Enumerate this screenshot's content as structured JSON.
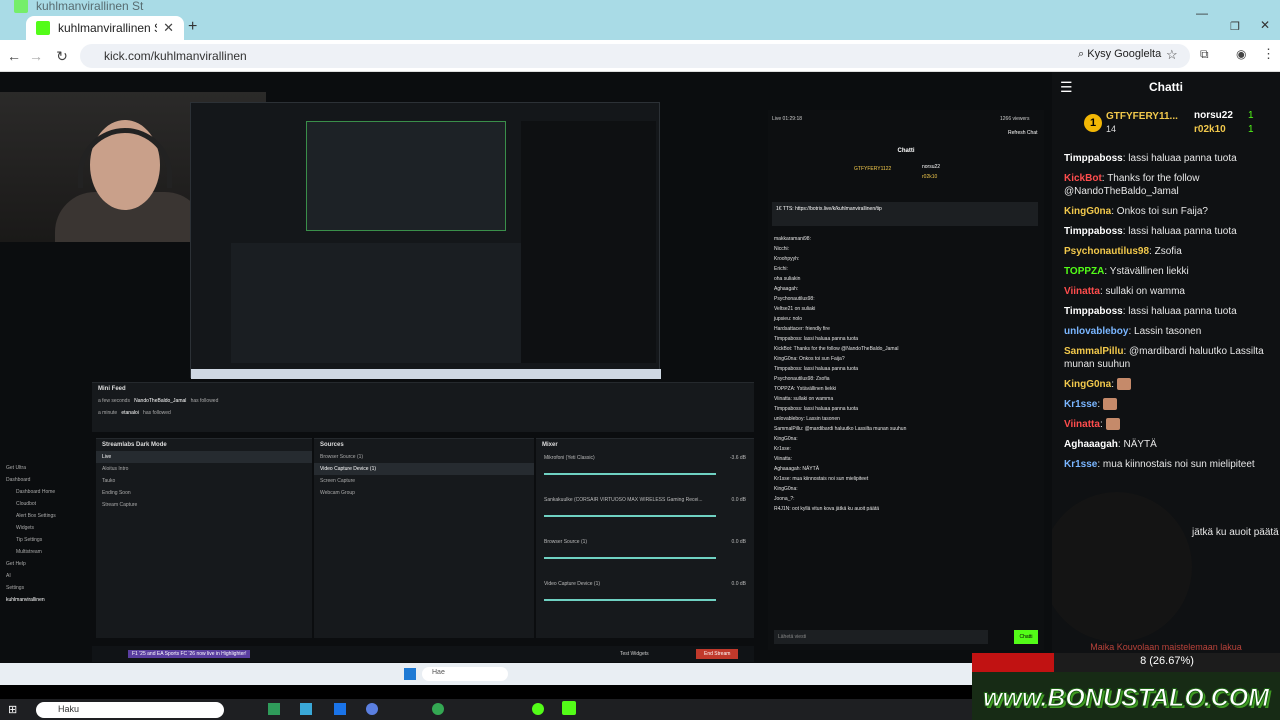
{
  "browser": {
    "tab1_title": "kuhlmanvirallinen Stream - Wa",
    "tab0_title": "kuhlmanvirallinen Stream - Wa",
    "url": "kick.com/kuhlmanvirallinen",
    "google_btn": "Kysy Googlelta"
  },
  "stream": {
    "live_time": "Live 01:29:18",
    "viewers": "1266 viewers",
    "refresh_chat": "Refresh Chat",
    "chat_title": "Chatti",
    "mini_feed": "Mini Feed",
    "feed": [
      {
        "time": "a few seconds",
        "user": "NandoTheBaldo_Jamal",
        "action": "has followed"
      },
      {
        "time": "a minute",
        "user": "etanaloi",
        "action": "has followed"
      }
    ],
    "scene_panel_title": "Streamlabs Dark Mode",
    "scenes": [
      "Live",
      "Aloitus Intro",
      "Tauko",
      "Ending Soon",
      "Stream Capture"
    ],
    "sources_title": "Sources",
    "sources": [
      "Browser Source (1)",
      "Video Capture Device (1)",
      "Screen Capture",
      "Webcam Group"
    ],
    "mixer_title": "Mixer",
    "mixer": [
      {
        "name": "Mikrofoni (Yeti Classic)",
        "db": "-3.6 dB"
      },
      {
        "name": "Sankakuulke (CORSAIR VIRTUOSO MAX WIRELESS Gaming Recei...",
        "db": "0.0 dB"
      },
      {
        "name": "Browser Source (1)",
        "db": "0.0 dB"
      },
      {
        "name": "Video Capture Device (1)",
        "db": "0.0 dB"
      }
    ],
    "sidebar": [
      "Get Ultra",
      "Dashboard",
      "Dashboard Home",
      "Cloudbot",
      "Alert Box Settings",
      "Widgets",
      "Tip Settings",
      "Multistream",
      "Get Help",
      "AI",
      "Settings"
    ],
    "channel": "kuhlmanvirallinen",
    "promo": "F1 '25 and EA Sports FC '26 now live in Highlighter!",
    "test_widgets": "Test Widgets",
    "end_stream": "End Stream",
    "embed_top1": "GTFYFERY1122",
    "embed_top2": "norsu22",
    "embed_top3": "r02k10",
    "embed_tts": "1€ TTS: https://botrix.live/k/kuhlmanvirallinen/tip",
    "embed_lines": [
      "makkaramani98:",
      "Nicchi:",
      "Kroohpyyh:",
      "Erichi:",
      "oha suliakin",
      "Aghaagah:",
      "Psychonautilus98:",
      "Veltse21 on suliaki",
      "jupsieu: nolo",
      "Hardsattacer: friendly fire",
      "Timppaboss: lassi haluaa panna tuota",
      "KickBot: Thanks for the follow @NandoTheBaldo_Jamal",
      "KingG0na: Onkos toi sun Faija?",
      "Timppaboss: lassi haluaa panna tuota",
      "Psychonautilus98: Zsofia",
      "TOPPZA: Ystävällinen liekki",
      "Viinatta: sullaki on wamma",
      "Timppaboss: lassi haluaa panna tuota",
      "unlovableboy: Lassin tasonen",
      "SammalPillu: @mardibardi haluutko Lassilta munan suuhun",
      "KingG0na:",
      "Kr1sse:",
      "Viinatta:",
      "Aghaaagah: NÄYTÄ",
      "Kr1sse: mua kiinnostais noi sun mielipiteet",
      "KingG0na:",
      "Joona_?:",
      "R4J1N: oot kyllä vitun kova jätkä ku auoit päätä"
    ],
    "embed_placeholder": "Lähetä viesti",
    "embed_send": "Chatti"
  },
  "chat": {
    "title": "Chatti",
    "leaders": [
      {
        "name": "GTFYFERY11...",
        "count": "14"
      },
      {
        "name": "norsu22",
        "count": "1"
      },
      {
        "name": "r02k10",
        "count": "1"
      }
    ],
    "messages": [
      {
        "user": "Timppaboss",
        "text": "lassi haluaa panna tuota",
        "color": "#ffffff"
      },
      {
        "user": "KickBot",
        "text": "Thanks for the follow @NandoTheBaldo_Jamal",
        "color": "#ff4d4d"
      },
      {
        "user": "KingG0na",
        "text": "Onkos toi sun Faija?",
        "color": "#f2c94c"
      },
      {
        "user": "Timppaboss",
        "text": "lassi haluaa panna tuota",
        "color": "#ffffff"
      },
      {
        "user": "Psychonautilus98",
        "text": "Zsofia",
        "color": "#f2c94c"
      },
      {
        "user": "TOPPZA",
        "text": "Ystävällinen liekki",
        "color": "#53fc18"
      },
      {
        "user": "Viinatta",
        "text": "sullaki on wamma",
        "color": "#ff4d4d"
      },
      {
        "user": "Timppaboss",
        "text": "lassi haluaa panna tuota",
        "color": "#ffffff"
      },
      {
        "user": "unlovableboy",
        "text": "Lassin tasonen",
        "color": "#7ab6ff"
      },
      {
        "user": "SammalPillu",
        "text": "@mardibardi haluutko Lassilta munan suuhun",
        "color": "#f2c94c"
      },
      {
        "user": "KingG0na",
        "text": "",
        "color": "#f2c94c"
      },
      {
        "user": "Kr1sse",
        "text": "",
        "color": "#7ab6ff"
      },
      {
        "user": "Viinatta",
        "text": "",
        "color": "#ff4d4d"
      },
      {
        "user": "Aghaaagah",
        "text": "NÄYTÄ",
        "color": "#ffffff"
      },
      {
        "user": "Kr1sse",
        "text": "mua kiinnostais noi sun mielipiteet",
        "color": "#7ab6ff"
      }
    ],
    "partial_text": "jätkä ku auoit päätä",
    "bottom_partial": "Maika Kouvolaan maistelemaan lakua"
  },
  "overlay": {
    "progress_text": "8 (26.67%)",
    "progress_fraction": 0.2667,
    "logo": "www.BONUSTALO.COM"
  },
  "taskbar": {
    "search": "Haku",
    "search2": "Hae"
  }
}
